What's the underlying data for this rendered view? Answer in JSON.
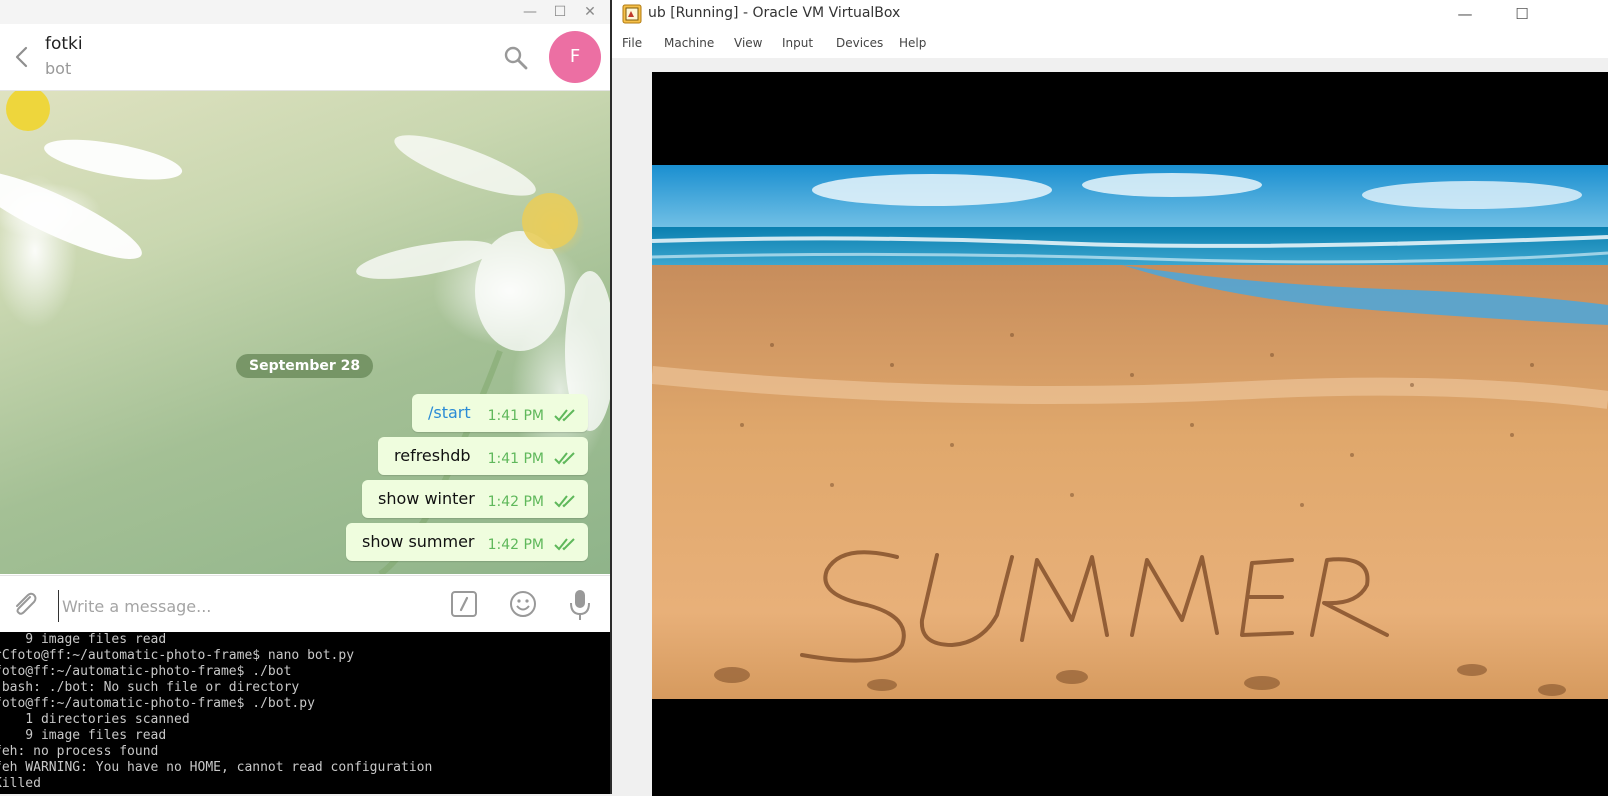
{
  "telegram": {
    "window_controls": {
      "minimize": "—",
      "maximize": "☐",
      "close": "✕"
    },
    "chat_name": "fotki",
    "chat_status": "bot",
    "avatar_letter": "F",
    "avatar_color": "#ec6fa3",
    "date_separator": "September 28",
    "messages": [
      {
        "text": "/start",
        "time": "1:41 PM",
        "is_command": true
      },
      {
        "text": "refreshdb",
        "time": "1:41 PM",
        "is_command": false
      },
      {
        "text": "show winter",
        "time": "1:42 PM",
        "is_command": false
      },
      {
        "text": "show summer",
        "time": "1:42 PM",
        "is_command": false
      }
    ],
    "composer": {
      "placeholder": "Write a message..."
    },
    "icons": [
      "back-icon",
      "search-icon",
      "attach-icon",
      "command-icon",
      "emoji-icon",
      "microphone-icon",
      "double-check-icon"
    ]
  },
  "terminal": {
    "lines": [
      "    9 image files read",
      "^Cfoto@ff:~/automatic-photo-frame$ nano bot.py",
      "foto@ff:~/automatic-photo-frame$ ./bot",
      "-bash: ./bot: No such file or directory",
      "foto@ff:~/automatic-photo-frame$ ./bot.py",
      "    1 directories scanned",
      "    9 image files read",
      "feh: no process found",
      "feh WARNING: You have no HOME, cannot read configuration",
      "Killed"
    ]
  },
  "virtualbox": {
    "title": "ub [Running] - Oracle VM VirtualBox",
    "window_controls": {
      "minimize": "—",
      "maximize": "☐"
    },
    "menu": [
      "File",
      "Machine",
      "View",
      "Input",
      "Devices",
      "Help"
    ],
    "screen_image_text": "SUMMER"
  }
}
